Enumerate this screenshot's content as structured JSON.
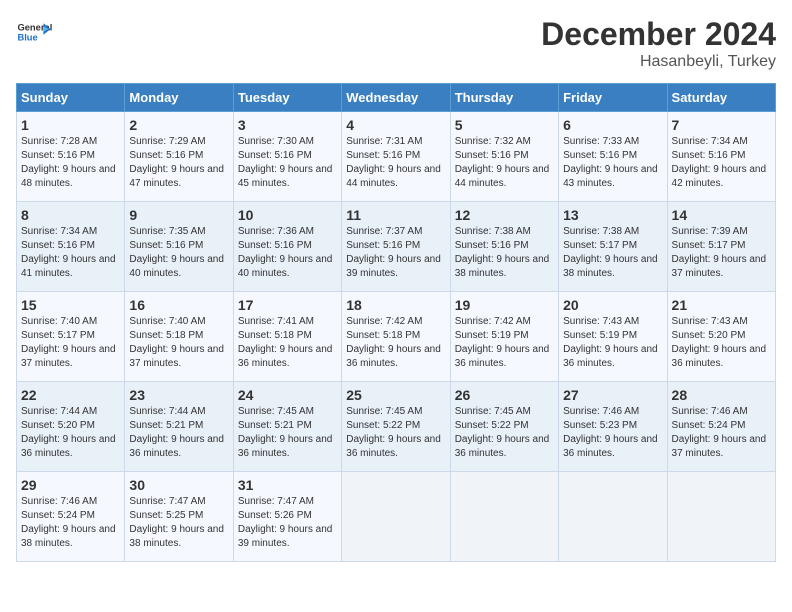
{
  "logo": {
    "line1": "General",
    "line2": "Blue",
    "arrow_color": "#1a73c8"
  },
  "title": "December 2024",
  "location": "Hasanbeyli, Turkey",
  "days_of_week": [
    "Sunday",
    "Monday",
    "Tuesday",
    "Wednesday",
    "Thursday",
    "Friday",
    "Saturday"
  ],
  "weeks": [
    [
      {
        "day": "1",
        "sunrise": "7:28 AM",
        "sunset": "5:16 PM",
        "daylight": "9 hours and 48 minutes."
      },
      {
        "day": "2",
        "sunrise": "7:29 AM",
        "sunset": "5:16 PM",
        "daylight": "9 hours and 47 minutes."
      },
      {
        "day": "3",
        "sunrise": "7:30 AM",
        "sunset": "5:16 PM",
        "daylight": "9 hours and 45 minutes."
      },
      {
        "day": "4",
        "sunrise": "7:31 AM",
        "sunset": "5:16 PM",
        "daylight": "9 hours and 44 minutes."
      },
      {
        "day": "5",
        "sunrise": "7:32 AM",
        "sunset": "5:16 PM",
        "daylight": "9 hours and 44 minutes."
      },
      {
        "day": "6",
        "sunrise": "7:33 AM",
        "sunset": "5:16 PM",
        "daylight": "9 hours and 43 minutes."
      },
      {
        "day": "7",
        "sunrise": "7:34 AM",
        "sunset": "5:16 PM",
        "daylight": "9 hours and 42 minutes."
      }
    ],
    [
      {
        "day": "8",
        "sunrise": "7:34 AM",
        "sunset": "5:16 PM",
        "daylight": "9 hours and 41 minutes."
      },
      {
        "day": "9",
        "sunrise": "7:35 AM",
        "sunset": "5:16 PM",
        "daylight": "9 hours and 40 minutes."
      },
      {
        "day": "10",
        "sunrise": "7:36 AM",
        "sunset": "5:16 PM",
        "daylight": "9 hours and 40 minutes."
      },
      {
        "day": "11",
        "sunrise": "7:37 AM",
        "sunset": "5:16 PM",
        "daylight": "9 hours and 39 minutes."
      },
      {
        "day": "12",
        "sunrise": "7:38 AM",
        "sunset": "5:16 PM",
        "daylight": "9 hours and 38 minutes."
      },
      {
        "day": "13",
        "sunrise": "7:38 AM",
        "sunset": "5:17 PM",
        "daylight": "9 hours and 38 minutes."
      },
      {
        "day": "14",
        "sunrise": "7:39 AM",
        "sunset": "5:17 PM",
        "daylight": "9 hours and 37 minutes."
      }
    ],
    [
      {
        "day": "15",
        "sunrise": "7:40 AM",
        "sunset": "5:17 PM",
        "daylight": "9 hours and 37 minutes."
      },
      {
        "day": "16",
        "sunrise": "7:40 AM",
        "sunset": "5:18 PM",
        "daylight": "9 hours and 37 minutes."
      },
      {
        "day": "17",
        "sunrise": "7:41 AM",
        "sunset": "5:18 PM",
        "daylight": "9 hours and 36 minutes."
      },
      {
        "day": "18",
        "sunrise": "7:42 AM",
        "sunset": "5:18 PM",
        "daylight": "9 hours and 36 minutes."
      },
      {
        "day": "19",
        "sunrise": "7:42 AM",
        "sunset": "5:19 PM",
        "daylight": "9 hours and 36 minutes."
      },
      {
        "day": "20",
        "sunrise": "7:43 AM",
        "sunset": "5:19 PM",
        "daylight": "9 hours and 36 minutes."
      },
      {
        "day": "21",
        "sunrise": "7:43 AM",
        "sunset": "5:20 PM",
        "daylight": "9 hours and 36 minutes."
      }
    ],
    [
      {
        "day": "22",
        "sunrise": "7:44 AM",
        "sunset": "5:20 PM",
        "daylight": "9 hours and 36 minutes."
      },
      {
        "day": "23",
        "sunrise": "7:44 AM",
        "sunset": "5:21 PM",
        "daylight": "9 hours and 36 minutes."
      },
      {
        "day": "24",
        "sunrise": "7:45 AM",
        "sunset": "5:21 PM",
        "daylight": "9 hours and 36 minutes."
      },
      {
        "day": "25",
        "sunrise": "7:45 AM",
        "sunset": "5:22 PM",
        "daylight": "9 hours and 36 minutes."
      },
      {
        "day": "26",
        "sunrise": "7:45 AM",
        "sunset": "5:22 PM",
        "daylight": "9 hours and 36 minutes."
      },
      {
        "day": "27",
        "sunrise": "7:46 AM",
        "sunset": "5:23 PM",
        "daylight": "9 hours and 36 minutes."
      },
      {
        "day": "28",
        "sunrise": "7:46 AM",
        "sunset": "5:24 PM",
        "daylight": "9 hours and 37 minutes."
      }
    ],
    [
      {
        "day": "29",
        "sunrise": "7:46 AM",
        "sunset": "5:24 PM",
        "daylight": "9 hours and 38 minutes."
      },
      {
        "day": "30",
        "sunrise": "7:47 AM",
        "sunset": "5:25 PM",
        "daylight": "9 hours and 38 minutes."
      },
      {
        "day": "31",
        "sunrise": "7:47 AM",
        "sunset": "5:26 PM",
        "daylight": "9 hours and 39 minutes."
      },
      null,
      null,
      null,
      null
    ]
  ]
}
